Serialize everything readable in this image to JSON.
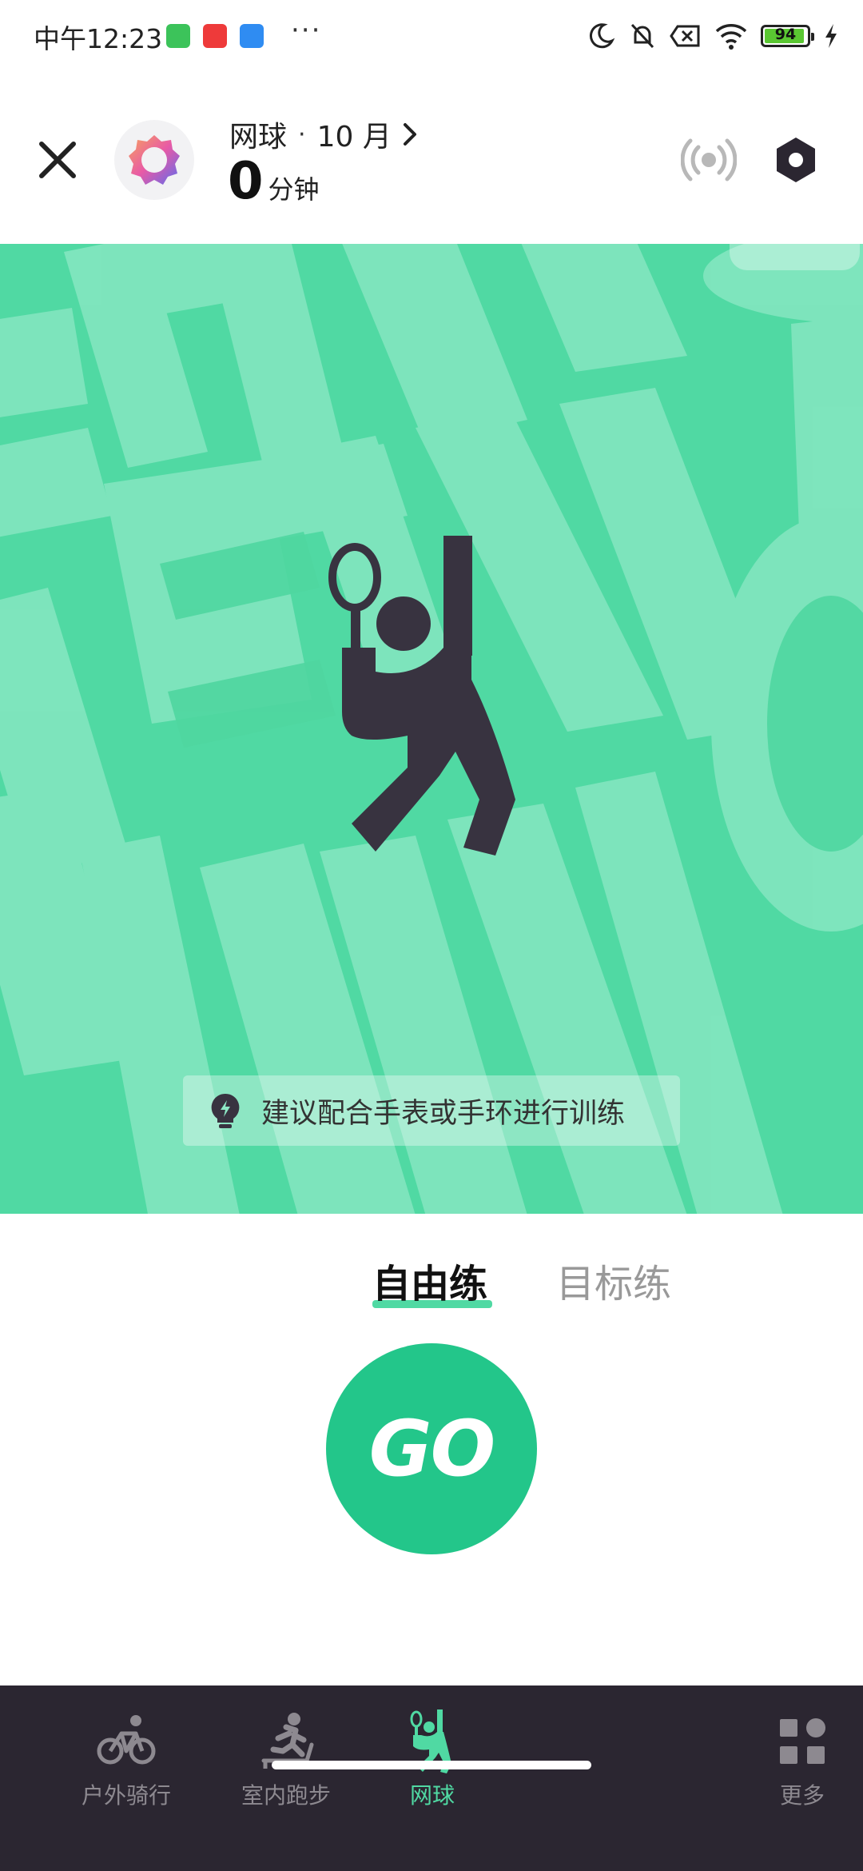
{
  "status_bar": {
    "time": "中午12:23",
    "more": "···",
    "battery": "94",
    "battery_level": 0.94,
    "colors": {
      "battery": "#5ac732"
    }
  },
  "header": {
    "sport": "网球",
    "separator": "·",
    "month": "10 月",
    "minutes": "0",
    "minutes_unit": "分钟",
    "icons": [
      "close-icon",
      "logo-icon",
      "chevron-right-icon",
      "broadcast-icon",
      "settings-icon"
    ]
  },
  "hero": {
    "bg_color": "#50d9a3",
    "tip": "建议配合手表或手环进行训练",
    "icons": [
      "tennis-player-icon",
      "lightbulb-icon"
    ]
  },
  "modes": {
    "free": "自由练",
    "target": "目标练",
    "active": "free"
  },
  "go_button": {
    "label": "GO",
    "color": "#23c68a"
  },
  "nav": {
    "items": [
      {
        "label": "户外骑行",
        "icon": "bike-icon",
        "active": false
      },
      {
        "label": "室内跑步",
        "icon": "treadmill-icon",
        "active": false
      },
      {
        "label": "网球",
        "icon": "tennis-icon",
        "active": true
      },
      {
        "label": "更多",
        "icon": "grid-icon",
        "active": false
      }
    ],
    "active_color": "#50d9a3",
    "inactive_color": "#8d8990"
  }
}
